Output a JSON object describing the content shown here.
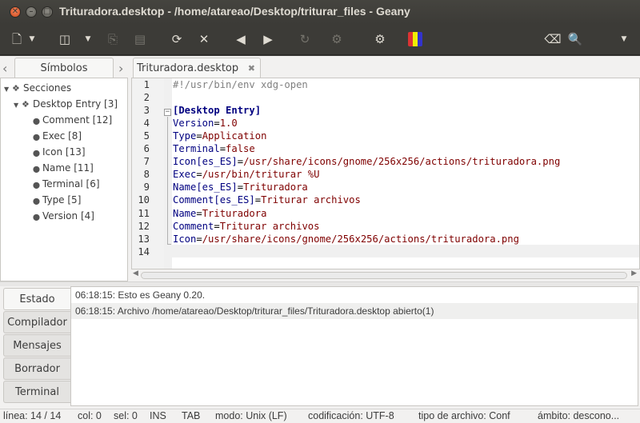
{
  "window": {
    "title": "Trituradora.desktop - /home/atareao/Desktop/triturar_files - Geany"
  },
  "toolbar": {
    "icons": [
      "new-file-icon",
      "open-file-icon",
      "save-icon",
      "save-all-icon",
      "reload-icon",
      "close-icon",
      "back-icon",
      "forward-icon",
      "compile-icon",
      "preferences-icon",
      "color-chooser-icon",
      "clear-icon",
      "search-icon",
      "dropdown-icon"
    ]
  },
  "sidebar": {
    "tab_label": "Símbolos",
    "tree": [
      {
        "label": "Secciones",
        "level": 0,
        "expanded": true
      },
      {
        "label": "Desktop Entry [3]",
        "level": 1,
        "expanded": true
      },
      {
        "label": "Comment [12]",
        "level": 2
      },
      {
        "label": "Exec [8]",
        "level": 2
      },
      {
        "label": "Icon [13]",
        "level": 2
      },
      {
        "label": "Name [11]",
        "level": 2
      },
      {
        "label": "Terminal [6]",
        "level": 2
      },
      {
        "label": "Type [5]",
        "level": 2
      },
      {
        "label": "Version [4]",
        "level": 2
      }
    ]
  },
  "editor": {
    "tab_label": "Trituradora.desktop",
    "lines": [
      {
        "n": "1",
        "kind": "shebang",
        "text": "#!/usr/bin/env xdg-open"
      },
      {
        "n": "2",
        "kind": "blank",
        "text": ""
      },
      {
        "n": "3",
        "kind": "section",
        "text": "[Desktop Entry]"
      },
      {
        "n": "4",
        "kind": "kv",
        "key": "Version",
        "value": "1.0"
      },
      {
        "n": "5",
        "kind": "kv",
        "key": "Type",
        "value": "Application"
      },
      {
        "n": "6",
        "kind": "kv",
        "key": "Terminal",
        "value": "false"
      },
      {
        "n": "7",
        "kind": "kv",
        "key": "Icon[es_ES]",
        "value": "/usr/share/icons/gnome/256x256/actions/trituradora.png"
      },
      {
        "n": "8",
        "kind": "kv",
        "key": "Exec",
        "value": "/usr/bin/triturar %U"
      },
      {
        "n": "9",
        "kind": "kv",
        "key": "Name[es_ES]",
        "value": "Trituradora"
      },
      {
        "n": "10",
        "kind": "kv",
        "key": "Comment[es_ES]",
        "value": "Triturar archivos"
      },
      {
        "n": "11",
        "kind": "kv",
        "key": "Name",
        "value": "Trituradora"
      },
      {
        "n": "12",
        "kind": "kv",
        "key": "Comment",
        "value": "Triturar archivos"
      },
      {
        "n": "13",
        "kind": "kv",
        "key": "Icon",
        "value": "/usr/share/icons/gnome/256x256/actions/trituradora.png"
      },
      {
        "n": "14",
        "kind": "blank",
        "text": ""
      }
    ]
  },
  "messages": {
    "tabs": [
      "Estado",
      "Compilador",
      "Mensajes",
      "Borrador",
      "Terminal"
    ],
    "active_tab": "Estado",
    "log": [
      "06:18:15: Esto es Geany 0.20.",
      "06:18:15: Archivo /home/atareao/Desktop/triturar_files/Trituradora.desktop abierto(1)"
    ]
  },
  "statusbar": {
    "line": "línea: 14 / 14",
    "col": "col: 0",
    "sel": "sel: 0",
    "ins": "INS",
    "tab": "TAB",
    "mode": "modo: Unix (LF)",
    "encoding": "codificación: UTF-8",
    "filetype": "tipo de archivo: Conf",
    "scope": "ámbito: descono..."
  },
  "colors": {
    "titlebar": "#3c3b37",
    "close_button": "#e0582a",
    "keyword": "#000080",
    "value": "#7f0000",
    "comment": "#808080"
  }
}
